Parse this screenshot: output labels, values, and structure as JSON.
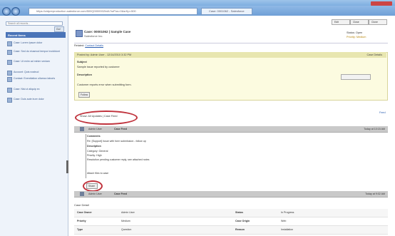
{
  "browser": {
    "url": "https://cidpreproduction.salesforce.com/500Q0000002lxIA?srPos=0&srKp=500",
    "tab_title": "Case: 0001062 - Salesforce"
  },
  "sidebar": {
    "search_placeholder": "Search all records...",
    "go_label": "Go!",
    "header": "Recent Items",
    "items": [
      {
        "label": "Case: Lorem Ipsum dolor"
      },
      {
        "label": "Case: Sed do eiusmod tempor incididunt"
      },
      {
        "label": "Case: Ut enim ad minim veniam"
      },
      {
        "label": "Account: Quis nostrud"
      },
      {
        "label": "Contact: Exercitation ullamco laboris"
      },
      {
        "label": "Case: Nisi ut aliquip ex"
      },
      {
        "label": "Case: Duis aute irure dolor"
      }
    ]
  },
  "main": {
    "top_buttons": [
      "Edit",
      "Close",
      "Clone"
    ],
    "record": {
      "title": "Case: 00001062 | Sample Case",
      "subtitle": "Salesforce Inc.",
      "status_lines": [
        "Status: Open",
        "Priority: Medium"
      ]
    },
    "relation": {
      "label": "Related:",
      "link": "Contact Details"
    },
    "summary": {
      "left": "Posted by: Admin User - 12/14/2010 3:32 PM",
      "right": "Case Details",
      "rows": [
        {
          "k": "Subject",
          "v": ""
        },
        {
          "k": "",
          "v": "Sample issue reported by customer"
        },
        {
          "k": "Description",
          "v": ""
        },
        {
          "k": "",
          "v": "Customer reports error when submitting form."
        }
      ],
      "button": "Follow"
    },
    "feed": {
      "filter_text": "Show: All Updates | Case Feed",
      "link": "Feed",
      "post1": {
        "author": "Admin User",
        "name": "Case Feed",
        "time": "Today at 10:15 AM",
        "lines": [
          "Comments",
          "Re: [Support] Issue with form submission - follow up",
          "Description",
          "Category: General",
          "Priority: High",
          "Resolution pending customer reply, see attached notes",
          "",
          "",
          "Attach files to case"
        ],
        "button": "Share"
      },
      "post2": {
        "author": "Admin User",
        "name": "Case Feed",
        "time": "Today at 9:02 AM"
      }
    },
    "detail": {
      "title": "Case Detail",
      "rows": [
        [
          "Case Owner",
          "Admin User",
          "Status",
          "In Progress"
        ],
        [
          "Priority",
          "Medium",
          "Case Origin",
          "Web"
        ],
        [
          "Type",
          "Question",
          "Reason",
          "Installation"
        ]
      ]
    }
  },
  "colors": {
    "accent": "#4a74b8",
    "highlight_circle": "#c0333d",
    "summary_bg": "#fcfbe0"
  }
}
